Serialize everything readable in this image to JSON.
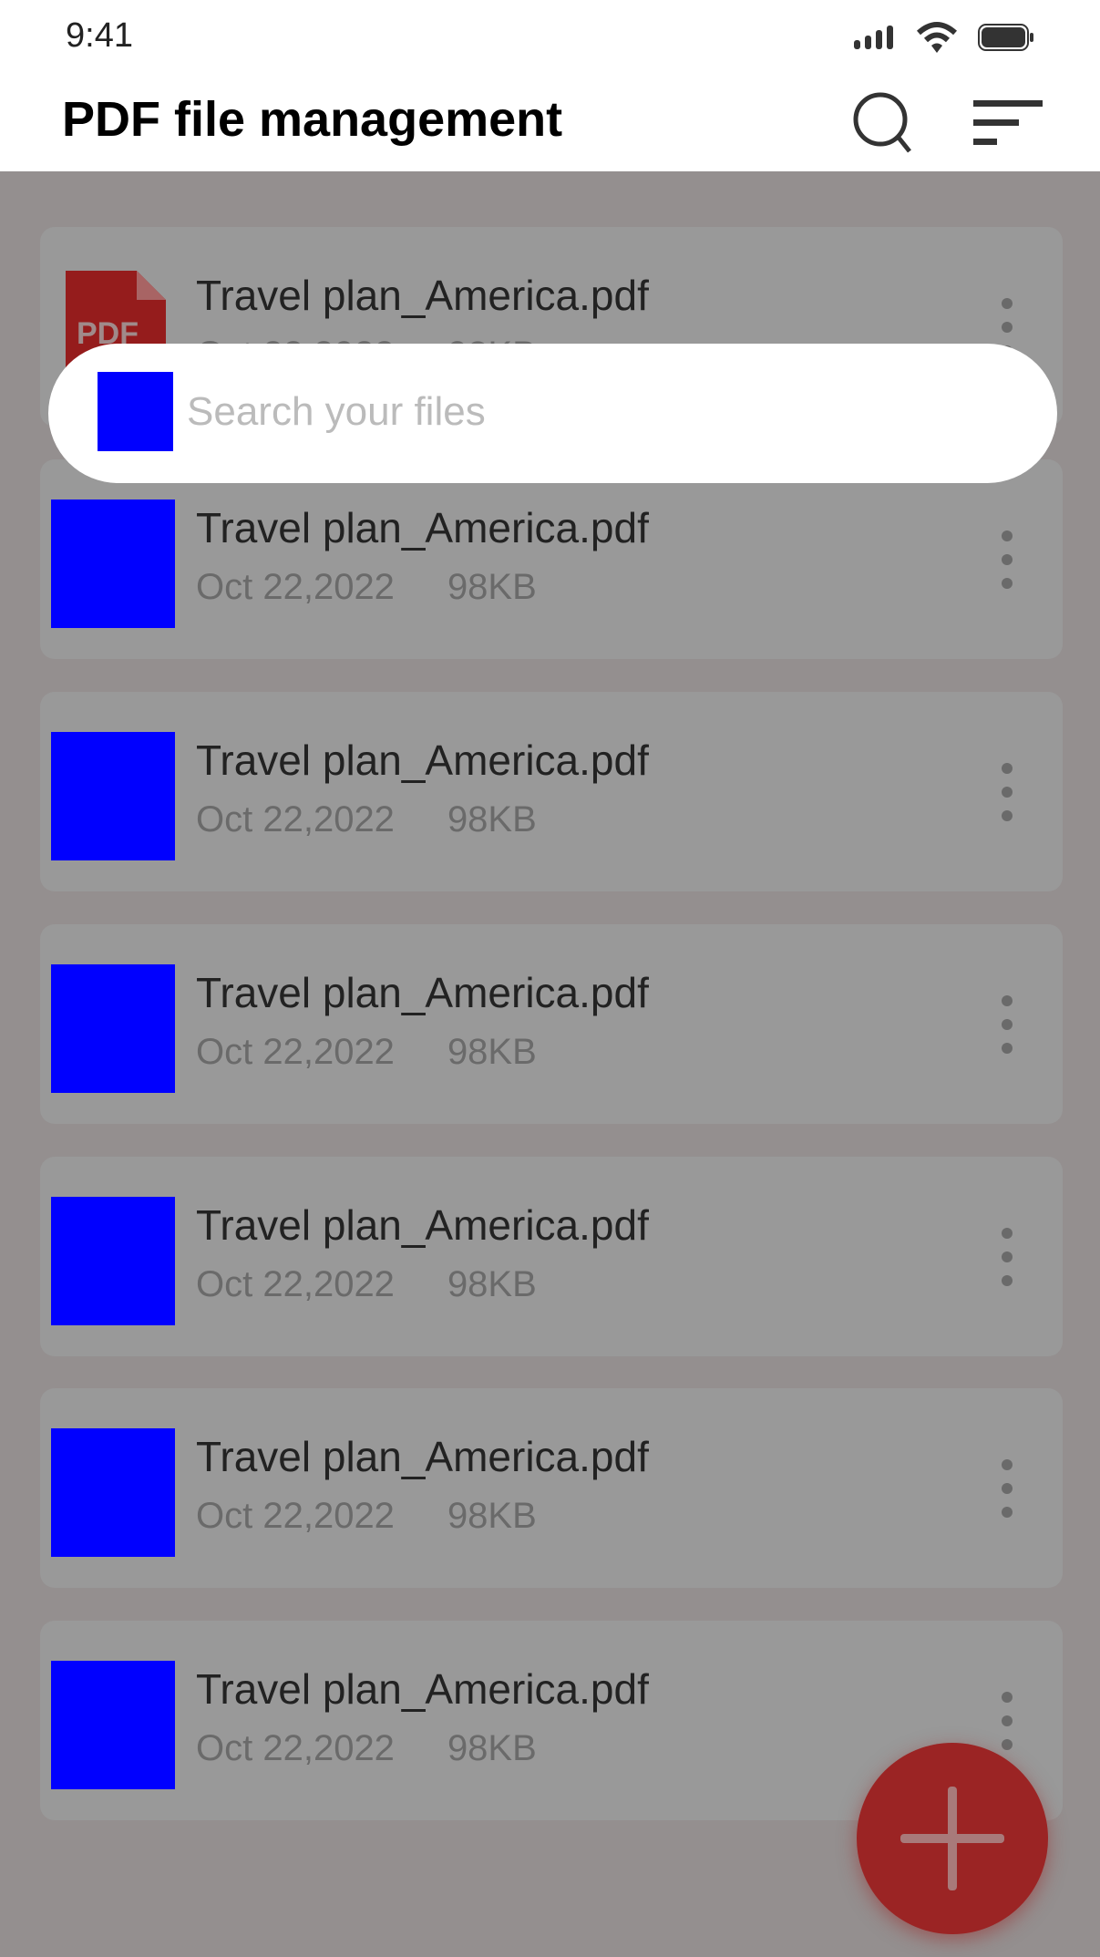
{
  "status_bar": {
    "time": "9:41"
  },
  "header": {
    "title": "PDF file management"
  },
  "search": {
    "placeholder": "Search your files"
  },
  "files": [
    {
      "name": "Travel plan_America.pdf",
      "date": "Oct 22,2022",
      "size": "98KB",
      "icon": "pdf-icon"
    },
    {
      "name": "Travel plan_America.pdf",
      "date": "Oct 22,2022",
      "size": "98KB"
    },
    {
      "name": "Travel plan_America.pdf",
      "date": "Oct 22,2022",
      "size": "98KB"
    },
    {
      "name": "Travel plan_America.pdf",
      "date": "Oct 22,2022",
      "size": "98KB"
    },
    {
      "name": "Travel plan_America.pdf",
      "date": "Oct 22,2022",
      "size": "98KB"
    },
    {
      "name": "Travel plan_America.pdf",
      "date": "Oct 22,2022",
      "size": "98KB"
    },
    {
      "name": "Travel plan_America.pdf",
      "date": "Oct 22,2022",
      "size": "98KB"
    }
  ],
  "colors": {
    "accent": "#9b2424",
    "overlay": "#948f8f",
    "card": "#999999"
  }
}
